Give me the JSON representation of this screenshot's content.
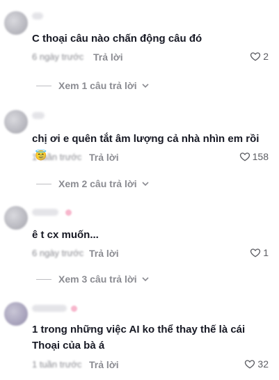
{
  "comments": [
    {
      "text": "C thoại câu nào chấn động câu đó",
      "time": "6 ngày trước",
      "reply": "Trả lời",
      "likes": "2",
      "view_replies": "Xem 1 câu trả lời"
    },
    {
      "text": "chị ơi e quên tắt âm lượng cả nhà nhìn em rồi",
      "emoji": "😇",
      "time": "1 tuần trước",
      "reply": "Trả lời",
      "likes": "158",
      "view_replies": "Xem 2 câu trả lời"
    },
    {
      "text": "ê t cx muốn...",
      "time": "6 ngày trước",
      "reply": "Trả lời",
      "likes": "1",
      "view_replies": "Xem 3 câu trả lời"
    },
    {
      "text": "1 trong những việc AI ko thể thay thế là cái Thoại của bà á",
      "time": "1 tuần trước",
      "reply": "Trả lời",
      "likes": "32"
    }
  ],
  "colors": {
    "text": "#161823",
    "muted": "#8a8b91"
  }
}
